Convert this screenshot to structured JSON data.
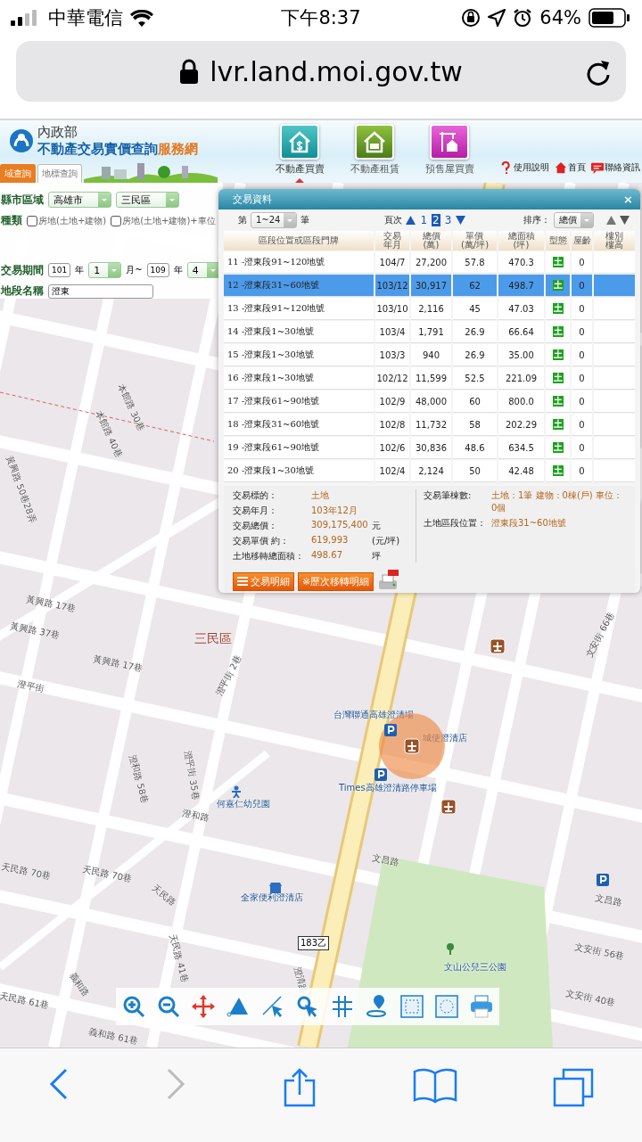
{
  "status_bar": {
    "carrier": "中華電信",
    "time": "下午8:37",
    "battery": "64%"
  },
  "url_bar": {
    "url": "lvr.land.moi.gov.tw"
  },
  "header": {
    "ministry": "內政部",
    "title": "不動產交易實價查詢",
    "title_accent": "服務網",
    "search_tabs": [
      {
        "label": "域查詢",
        "selected": true
      },
      {
        "label": "地標查詢",
        "selected": false
      }
    ],
    "nav": [
      {
        "kind": "sale",
        "label": "不動產買賣",
        "selected": true
      },
      {
        "kind": "rent",
        "label": "不動產租賃",
        "selected": false
      },
      {
        "kind": "presale",
        "label": "預售屋買賣",
        "selected": false
      }
    ],
    "links": [
      {
        "kind": "help",
        "label": "使用說明"
      },
      {
        "kind": "home",
        "label": "首頁"
      },
      {
        "kind": "contact",
        "label": "聯絡資訊"
      }
    ]
  },
  "search_panel": {
    "region_label": "縣市區域",
    "city": "高雄市",
    "district": "三民區",
    "type_label": "種類",
    "type_options": [
      {
        "label": "房地(土地+建物)",
        "checked": false
      },
      {
        "label": "房地(土地+建物)+車位",
        "checked": false
      }
    ],
    "period_label": "交易期間",
    "from_year": "101",
    "year_unit": "年",
    "from_month": "1",
    "month_unit": "月~",
    "to_year": "109",
    "to_year_unit": "年",
    "to_month": "4",
    "section_label": "地段名稱",
    "section_value": "澄東"
  },
  "dialog": {
    "title": "交易資料",
    "close": "×",
    "range_prefix": "第",
    "range": "1~24",
    "range_suffix": "筆",
    "page_label": "頁次",
    "pages": [
      {
        "label": "1",
        "selected": false
      },
      {
        "label": "2",
        "selected": true
      },
      {
        "label": "3",
        "selected": false
      }
    ],
    "sort_label": "排序：",
    "sort_value": "總價",
    "columns": [
      {
        "lines": [
          "區段位置或區段門牌"
        ]
      },
      {
        "lines": [
          "交易",
          "年月"
        ]
      },
      {
        "lines": [
          "總價",
          "(萬)"
        ]
      },
      {
        "lines": [
          "單價",
          "(萬/坪)"
        ]
      },
      {
        "lines": [
          "總面積",
          "(坪)"
        ]
      },
      {
        "lines": [
          "型態"
        ]
      },
      {
        "lines": [
          "屋齡"
        ]
      },
      {
        "lines": [
          "樓別",
          "樓高"
        ]
      }
    ],
    "rows": [
      {
        "location": "11 -澄東段91~120地號",
        "date": "104/7",
        "total": "27,200",
        "unit": "57.8",
        "area": "470.3",
        "type": "土",
        "age": "0",
        "selected": false
      },
      {
        "location": "12 -澄東段31~60地號",
        "date": "103/12",
        "total": "30,917",
        "unit": "62",
        "area": "498.7",
        "type": "土",
        "age": "0",
        "selected": true
      },
      {
        "location": "13 -澄東段91~120地號",
        "date": "103/10",
        "total": "2,116",
        "unit": "45",
        "area": "47.03",
        "type": "土",
        "age": "0",
        "selected": false
      },
      {
        "location": "14 -澄東段1~30地號",
        "date": "103/4",
        "total": "1,791",
        "unit": "26.9",
        "area": "66.64",
        "type": "土",
        "age": "0",
        "selected": false
      },
      {
        "location": "15 -澄東段1~30地號",
        "date": "103/3",
        "total": "940",
        "unit": "26.9",
        "area": "35.00",
        "type": "土",
        "age": "0",
        "selected": false
      },
      {
        "location": "16 -澄東段1~30地號",
        "date": "102/12",
        "total": "11,599",
        "unit": "52.5",
        "area": "221.09",
        "type": "土",
        "age": "0",
        "selected": false
      },
      {
        "location": "17 -澄東段61~90地號",
        "date": "102/9",
        "total": "48,000",
        "unit": "60",
        "area": "800.0",
        "type": "土",
        "age": "0",
        "selected": false
      },
      {
        "location": "18 -澄東段31~60地號",
        "date": "102/8",
        "total": "11,732",
        "unit": "58",
        "area": "202.29",
        "type": "土",
        "age": "0",
        "selected": false
      },
      {
        "location": "19 -澄東段61~90地號",
        "date": "102/6",
        "total": "30,836",
        "unit": "48.6",
        "area": "634.5",
        "type": "土",
        "age": "0",
        "selected": false
      },
      {
        "location": "20 -澄東段1~30地號",
        "date": "102/4",
        "total": "2,124",
        "unit": "50",
        "area": "42.48",
        "type": "土",
        "age": "0",
        "selected": false
      }
    ],
    "detail_left": [
      {
        "label": "交易標的：",
        "value": "土地"
      },
      {
        "label": "交易年月：",
        "value": "103年12月"
      },
      {
        "label": "交易總價：",
        "value": "309,175,400",
        "unit": "元"
      },
      {
        "label": "交易單價 約：",
        "value": "619,993",
        "unit": "(元/坪)"
      },
      {
        "label": "土地移轉總面積：",
        "value": "498.67",
        "unit": "坪"
      }
    ],
    "detail_right": [
      {
        "label": "交易筆棟數:",
        "value": "土地：1筆 建物：0棟(戶) 車位：0個"
      },
      {
        "label": "土地區段位置：",
        "value": "澄東段31~60地號"
      }
    ],
    "buttons": [
      {
        "kind": "list",
        "label": "交易明細"
      },
      {
        "kind": "plain",
        "label": "※歷次移轉明細"
      }
    ]
  },
  "map": {
    "district": "三民區",
    "streets": [
      "黃興路 50巷28弄",
      "本館路 30巷",
      "本館路 40巷",
      "黃興路 17巷",
      "黃興路 37巷",
      "黃興路 17巷",
      "澄平街",
      "澄平街 2巷",
      "澄和路 58巷",
      "澄平街 35巷",
      "澄和路",
      "天民路 70巷",
      "天民路 70巷",
      "天民路",
      "天民路 41巷",
      "義和路",
      "天民路 61巷",
      "義和路 61巷",
      "文昌路",
      "文昌路",
      "文安街 56巷",
      "文安街 40巷",
      "文安街 66巷",
      "澄清路"
    ],
    "places": [
      "台灣聯通高雄澄清場",
      "城使澄清店",
      "Times高雄澄清路停車場",
      "何嘉仁幼兒園",
      "全家便利澄清店",
      "文山公兒三公園"
    ],
    "road_shield": "183乙"
  }
}
